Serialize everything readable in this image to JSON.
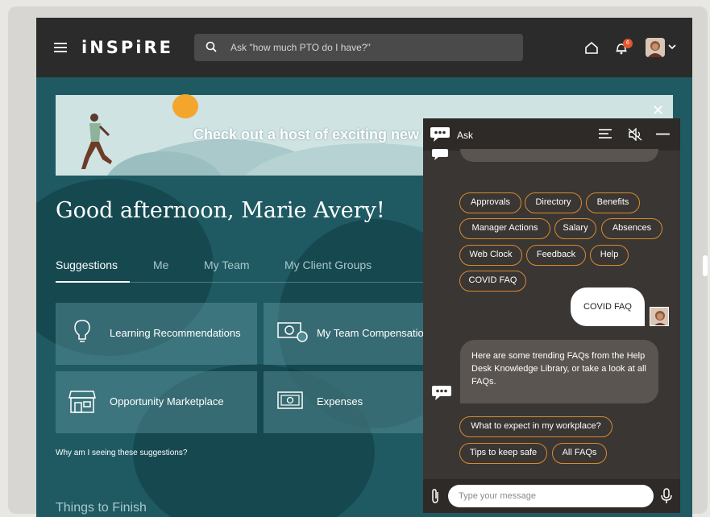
{
  "header": {
    "logo": "iNSPiRE",
    "search_placeholder": "Ask \"how much PTO do I have?\"",
    "notification_count": "6"
  },
  "banner": {
    "text": "Check out a host of exciting new"
  },
  "greeting": "Good afternoon, Marie Avery!",
  "tabs": [
    {
      "label": "Suggestions",
      "active": true
    },
    {
      "label": "Me"
    },
    {
      "label": "My Team"
    },
    {
      "label": "My Client Groups"
    }
  ],
  "cards": [
    {
      "label": "Learning Recommendations",
      "icon": "lightbulb-icon"
    },
    {
      "label": "My Team Compensation",
      "icon": "money-icon"
    },
    {
      "label": "Opportunity Marketplace",
      "icon": "storefront-icon"
    },
    {
      "label": "Expenses",
      "icon": "expenses-icon"
    }
  ],
  "why_text": "Why am I seeing these suggestions?",
  "things_title": "Things to Finish",
  "chat": {
    "title": "Ask",
    "chips": [
      "Approvals",
      "Directory",
      "Benefits",
      "Manager Actions",
      "Salary",
      "Absences",
      "Web Clock",
      "Feedback",
      "Help",
      "COVID FAQ"
    ],
    "user_message": "COVID FAQ",
    "bot_message": "Here are some trending FAQs from the Help Desk Knowledge Library, or take a look at all FAQs.",
    "faq_chips": [
      "What to expect in my workplace?",
      "Tips to keep safe",
      "All FAQs"
    ],
    "input_placeholder": "Type your message"
  },
  "colors": {
    "accent_orange": "#d88a2f",
    "teal_bg": "#1f5a63",
    "header_bg": "#2b2b2b",
    "chat_bg": "#3a3633"
  }
}
